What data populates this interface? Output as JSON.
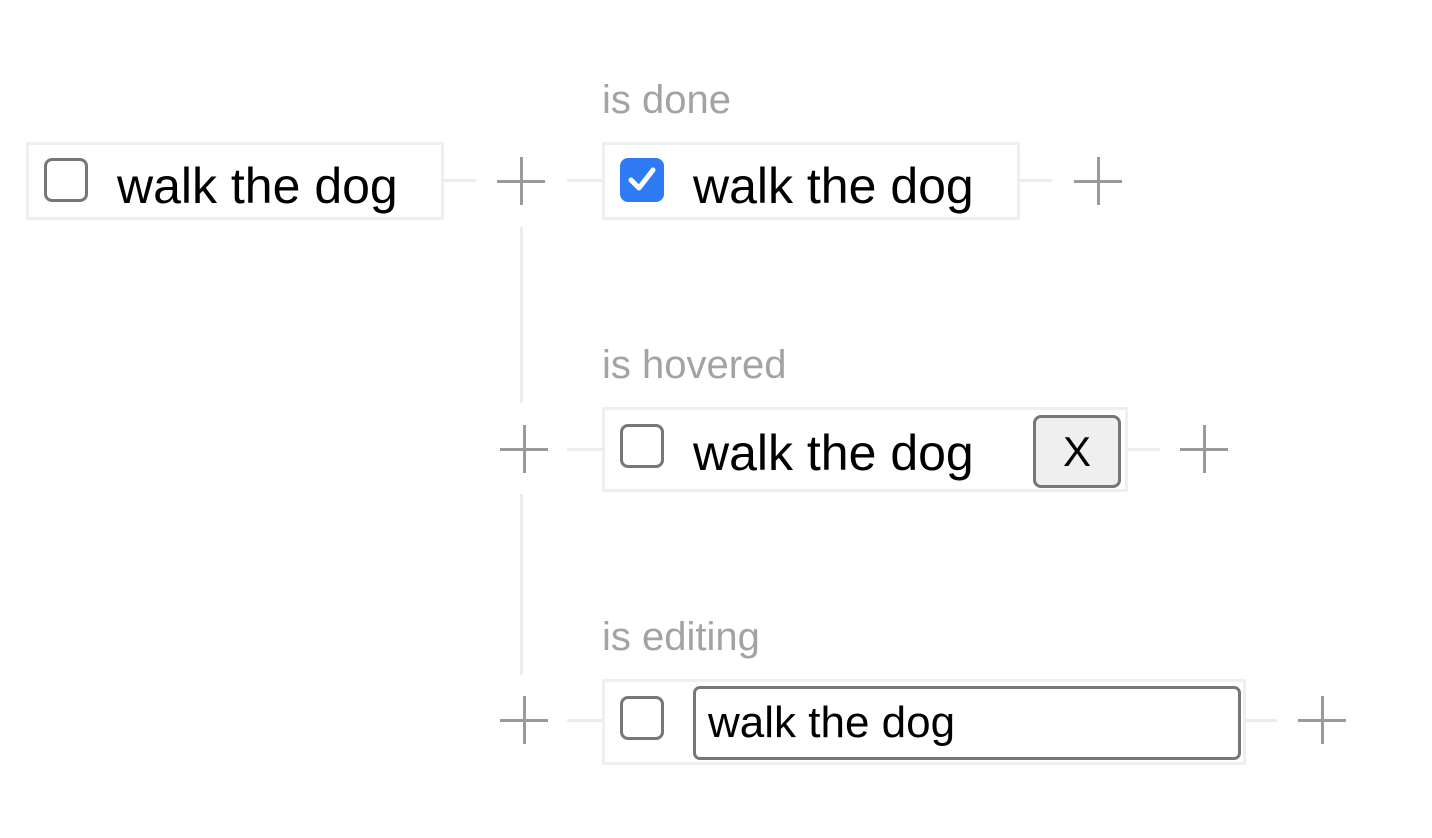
{
  "base": {
    "text": "walk the dog",
    "checked": false
  },
  "states": [
    {
      "label": "is done",
      "text": "walk the dog",
      "checked": true
    },
    {
      "label": "is hovered",
      "text": "walk the dog",
      "checked": false,
      "delete_label": "X"
    },
    {
      "label": "is editing",
      "value": "walk the dog",
      "checked": false
    }
  ],
  "colors": {
    "checkbox_checked": "#2f7bf5",
    "label": "#a3a3a3",
    "connector": "#ececec",
    "plus": "#9a9a9a"
  },
  "icons": {
    "add": "plus-icon",
    "check": "checkmark-icon"
  }
}
